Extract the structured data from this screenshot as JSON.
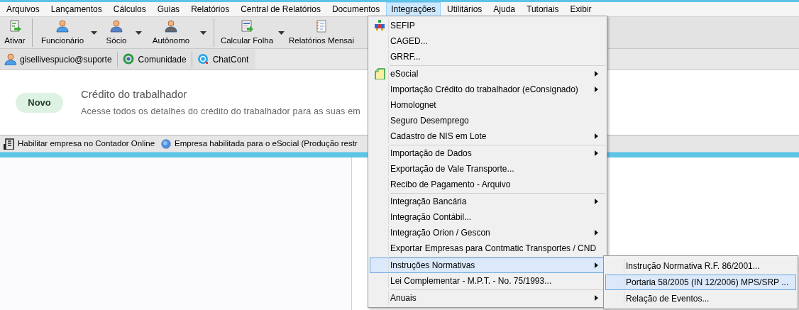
{
  "menu_bar": [
    {
      "label": "Arquivos",
      "selected": false
    },
    {
      "label": "Lançamentos",
      "selected": false
    },
    {
      "label": "Cálculos",
      "selected": false
    },
    {
      "label": "Guias",
      "selected": false
    },
    {
      "label": "Relatórios",
      "selected": false
    },
    {
      "label": "Central de Relatórios",
      "selected": false
    },
    {
      "label": "Documentos",
      "selected": false
    },
    {
      "label": "Integrações",
      "selected": true
    },
    {
      "label": "Utilitários",
      "selected": false
    },
    {
      "label": "Ajuda",
      "selected": false
    },
    {
      "label": "Tutoriais",
      "selected": false
    },
    {
      "label": "Exibir",
      "selected": false
    }
  ],
  "toolbar": [
    {
      "label": "Ativar",
      "dropdown": false
    },
    {
      "label": "Funcionário",
      "dropdown": true
    },
    {
      "label": "Sócio",
      "dropdown": true
    },
    {
      "label": "Autônomo",
      "dropdown": true
    },
    {
      "label": "Calcular Folha",
      "dropdown": true
    },
    {
      "label": "Relatórios Mensai",
      "dropdown": false
    }
  ],
  "user_bar": [
    {
      "label": "gisellivespucio@suporte"
    },
    {
      "label": "Comunidade"
    },
    {
      "label": "ChatCont"
    }
  ],
  "banner": {
    "badge": "Novo",
    "title": "Crédito do trabalhador",
    "description": "Acesse todos os detalhes do crédito do trabalhador para as suas em"
  },
  "status_bar": [
    {
      "label": "Habilitar empresa no Contador Online"
    },
    {
      "label": "Empresa habilitada para o eSocial (Produção restr"
    }
  ],
  "menu": {
    "items": [
      {
        "kind": "item",
        "label": "SEFIP",
        "submenu": false,
        "selected": false
      },
      {
        "kind": "item",
        "label": "CAGED...",
        "submenu": false,
        "selected": false
      },
      {
        "kind": "item",
        "label": "GRRF...",
        "submenu": false,
        "selected": false
      },
      {
        "kind": "separator"
      },
      {
        "kind": "item",
        "label": "eSocial",
        "submenu": true,
        "selected": false
      },
      {
        "kind": "item",
        "label": "Importação Crédito do trabalhador (eConsignado)",
        "submenu": true,
        "selected": false
      },
      {
        "kind": "item",
        "label": "Homolognet",
        "submenu": false,
        "selected": false
      },
      {
        "kind": "item",
        "label": "Seguro Desemprego",
        "submenu": false,
        "selected": false
      },
      {
        "kind": "item",
        "label": "Cadastro de NIS em Lote",
        "submenu": true,
        "selected": false
      },
      {
        "kind": "separator"
      },
      {
        "kind": "item",
        "label": "Importação de Dados",
        "submenu": true,
        "selected": false
      },
      {
        "kind": "item",
        "label": "Exportação de Vale Transporte...",
        "submenu": false,
        "selected": false
      },
      {
        "kind": "item",
        "label": "Recibo de Pagamento - Arquivo",
        "submenu": false,
        "selected": false
      },
      {
        "kind": "separator"
      },
      {
        "kind": "item",
        "label": "Integração Bancária",
        "submenu": true,
        "selected": false
      },
      {
        "kind": "item",
        "label": "Integração Contábil...",
        "submenu": false,
        "selected": false
      },
      {
        "kind": "item",
        "label": "Integração Orion / Gescon",
        "submenu": true,
        "selected": false
      },
      {
        "kind": "item",
        "label": "Exportar Empresas para Contmatic Transportes / CND",
        "submenu": false,
        "selected": false
      },
      {
        "kind": "separator"
      },
      {
        "kind": "item",
        "label": "Instruções Normativas",
        "submenu": true,
        "selected": true
      },
      {
        "kind": "item",
        "label": "Lei Complementar - M.P.T. - No. 75/1993...",
        "submenu": false,
        "selected": false
      },
      {
        "kind": "separator"
      },
      {
        "kind": "item",
        "label": "Anuais",
        "submenu": true,
        "selected": false
      }
    ]
  },
  "submenu": {
    "items": [
      {
        "label": "Instrução Normativa R.F. 86/2001...",
        "selected": false
      },
      {
        "label": "Portaria  58/2005 (IN 12/2006) MPS/SRP ...",
        "selected": true
      },
      {
        "label": "Relação de Eventos...",
        "selected": false
      }
    ]
  }
}
